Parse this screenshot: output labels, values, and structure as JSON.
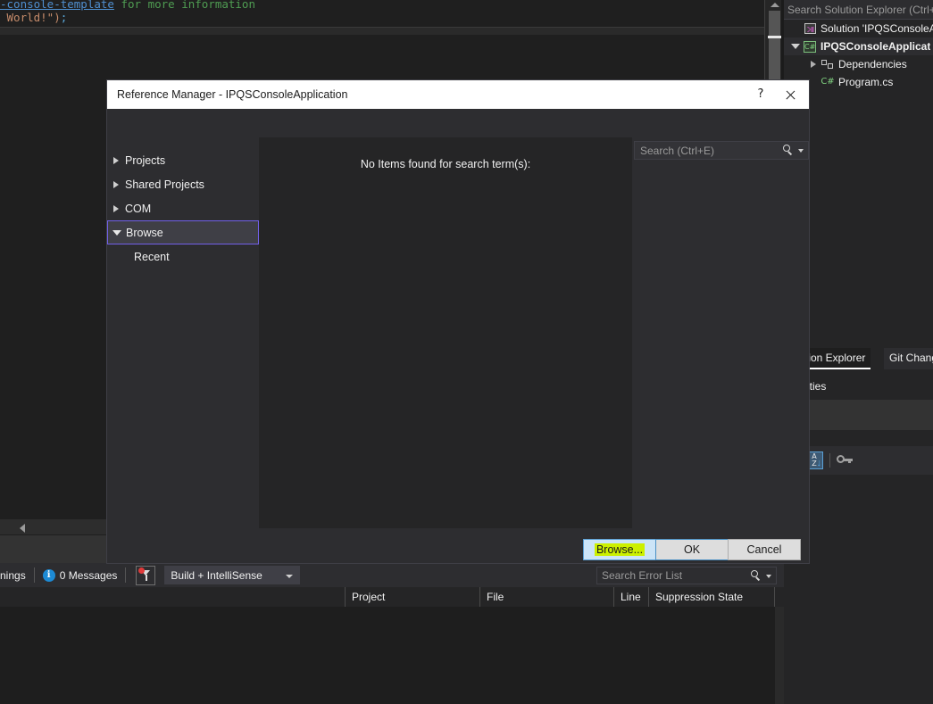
{
  "editor": {
    "line1_link": "-console-template",
    "line1_comment": " for more information",
    "line2_str": "World!\")",
    "line2_end": ";"
  },
  "solution_explorer": {
    "search_placeholder": "Search Solution Explorer (Ctrl+",
    "items": [
      {
        "label": "Solution 'IPQSConsoleAp",
        "icon": "solution-icon",
        "twisty": "none",
        "bold": false
      },
      {
        "label": "IPQSConsoleApplicat",
        "icon": "csharp-project-icon",
        "twisty": "down",
        "bold": true
      },
      {
        "label": "Dependencies",
        "icon": "dependencies-icon",
        "twisty": "right",
        "bold": false
      },
      {
        "label": "Program.cs",
        "icon": "csharp-file-icon",
        "twisty": "none",
        "bold": false
      }
    ]
  },
  "right_tabs": {
    "active": "tion Explorer",
    "inactive": "Git Change"
  },
  "properties": {
    "title": "erties",
    "sort_icon": "sort-az-icon",
    "wrench_icon": "wrench-icon"
  },
  "error_list": {
    "warnings_label": "nings",
    "messages_label": "0 Messages",
    "info_glyph": "i",
    "filter_icon": "filter-icon",
    "scope_value": "Build + IntelliSense",
    "search_placeholder": "Search Error List",
    "columns": [
      "Project",
      "File",
      "Line",
      "Suppression State"
    ]
  },
  "dialog": {
    "title": "Reference Manager - IPQSConsoleApplication",
    "help_glyph": "?",
    "close_icon": "close-icon",
    "search_placeholder": "Search (Ctrl+E)",
    "nav_items": [
      {
        "label": "Projects",
        "twisty": "right",
        "selected": false,
        "child": false
      },
      {
        "label": "Shared Projects",
        "twisty": "right",
        "selected": false,
        "child": false
      },
      {
        "label": "COM",
        "twisty": "right",
        "selected": false,
        "child": false
      },
      {
        "label": "Browse",
        "twisty": "down",
        "selected": true,
        "child": false
      },
      {
        "label": "Recent",
        "twisty": "none",
        "selected": false,
        "child": true
      }
    ],
    "empty_message": "No Items found for search term(s):",
    "buttons": {
      "browse": "Browse...",
      "ok": "OK",
      "cancel": "Cancel"
    }
  },
  "colors": {
    "accent_selection": "#7160e8",
    "highlight_marker": "#ccf000",
    "button_hover": "#cce4f7",
    "info_badge": "#1d8ad4",
    "filter_dot": "#e03a3a"
  }
}
